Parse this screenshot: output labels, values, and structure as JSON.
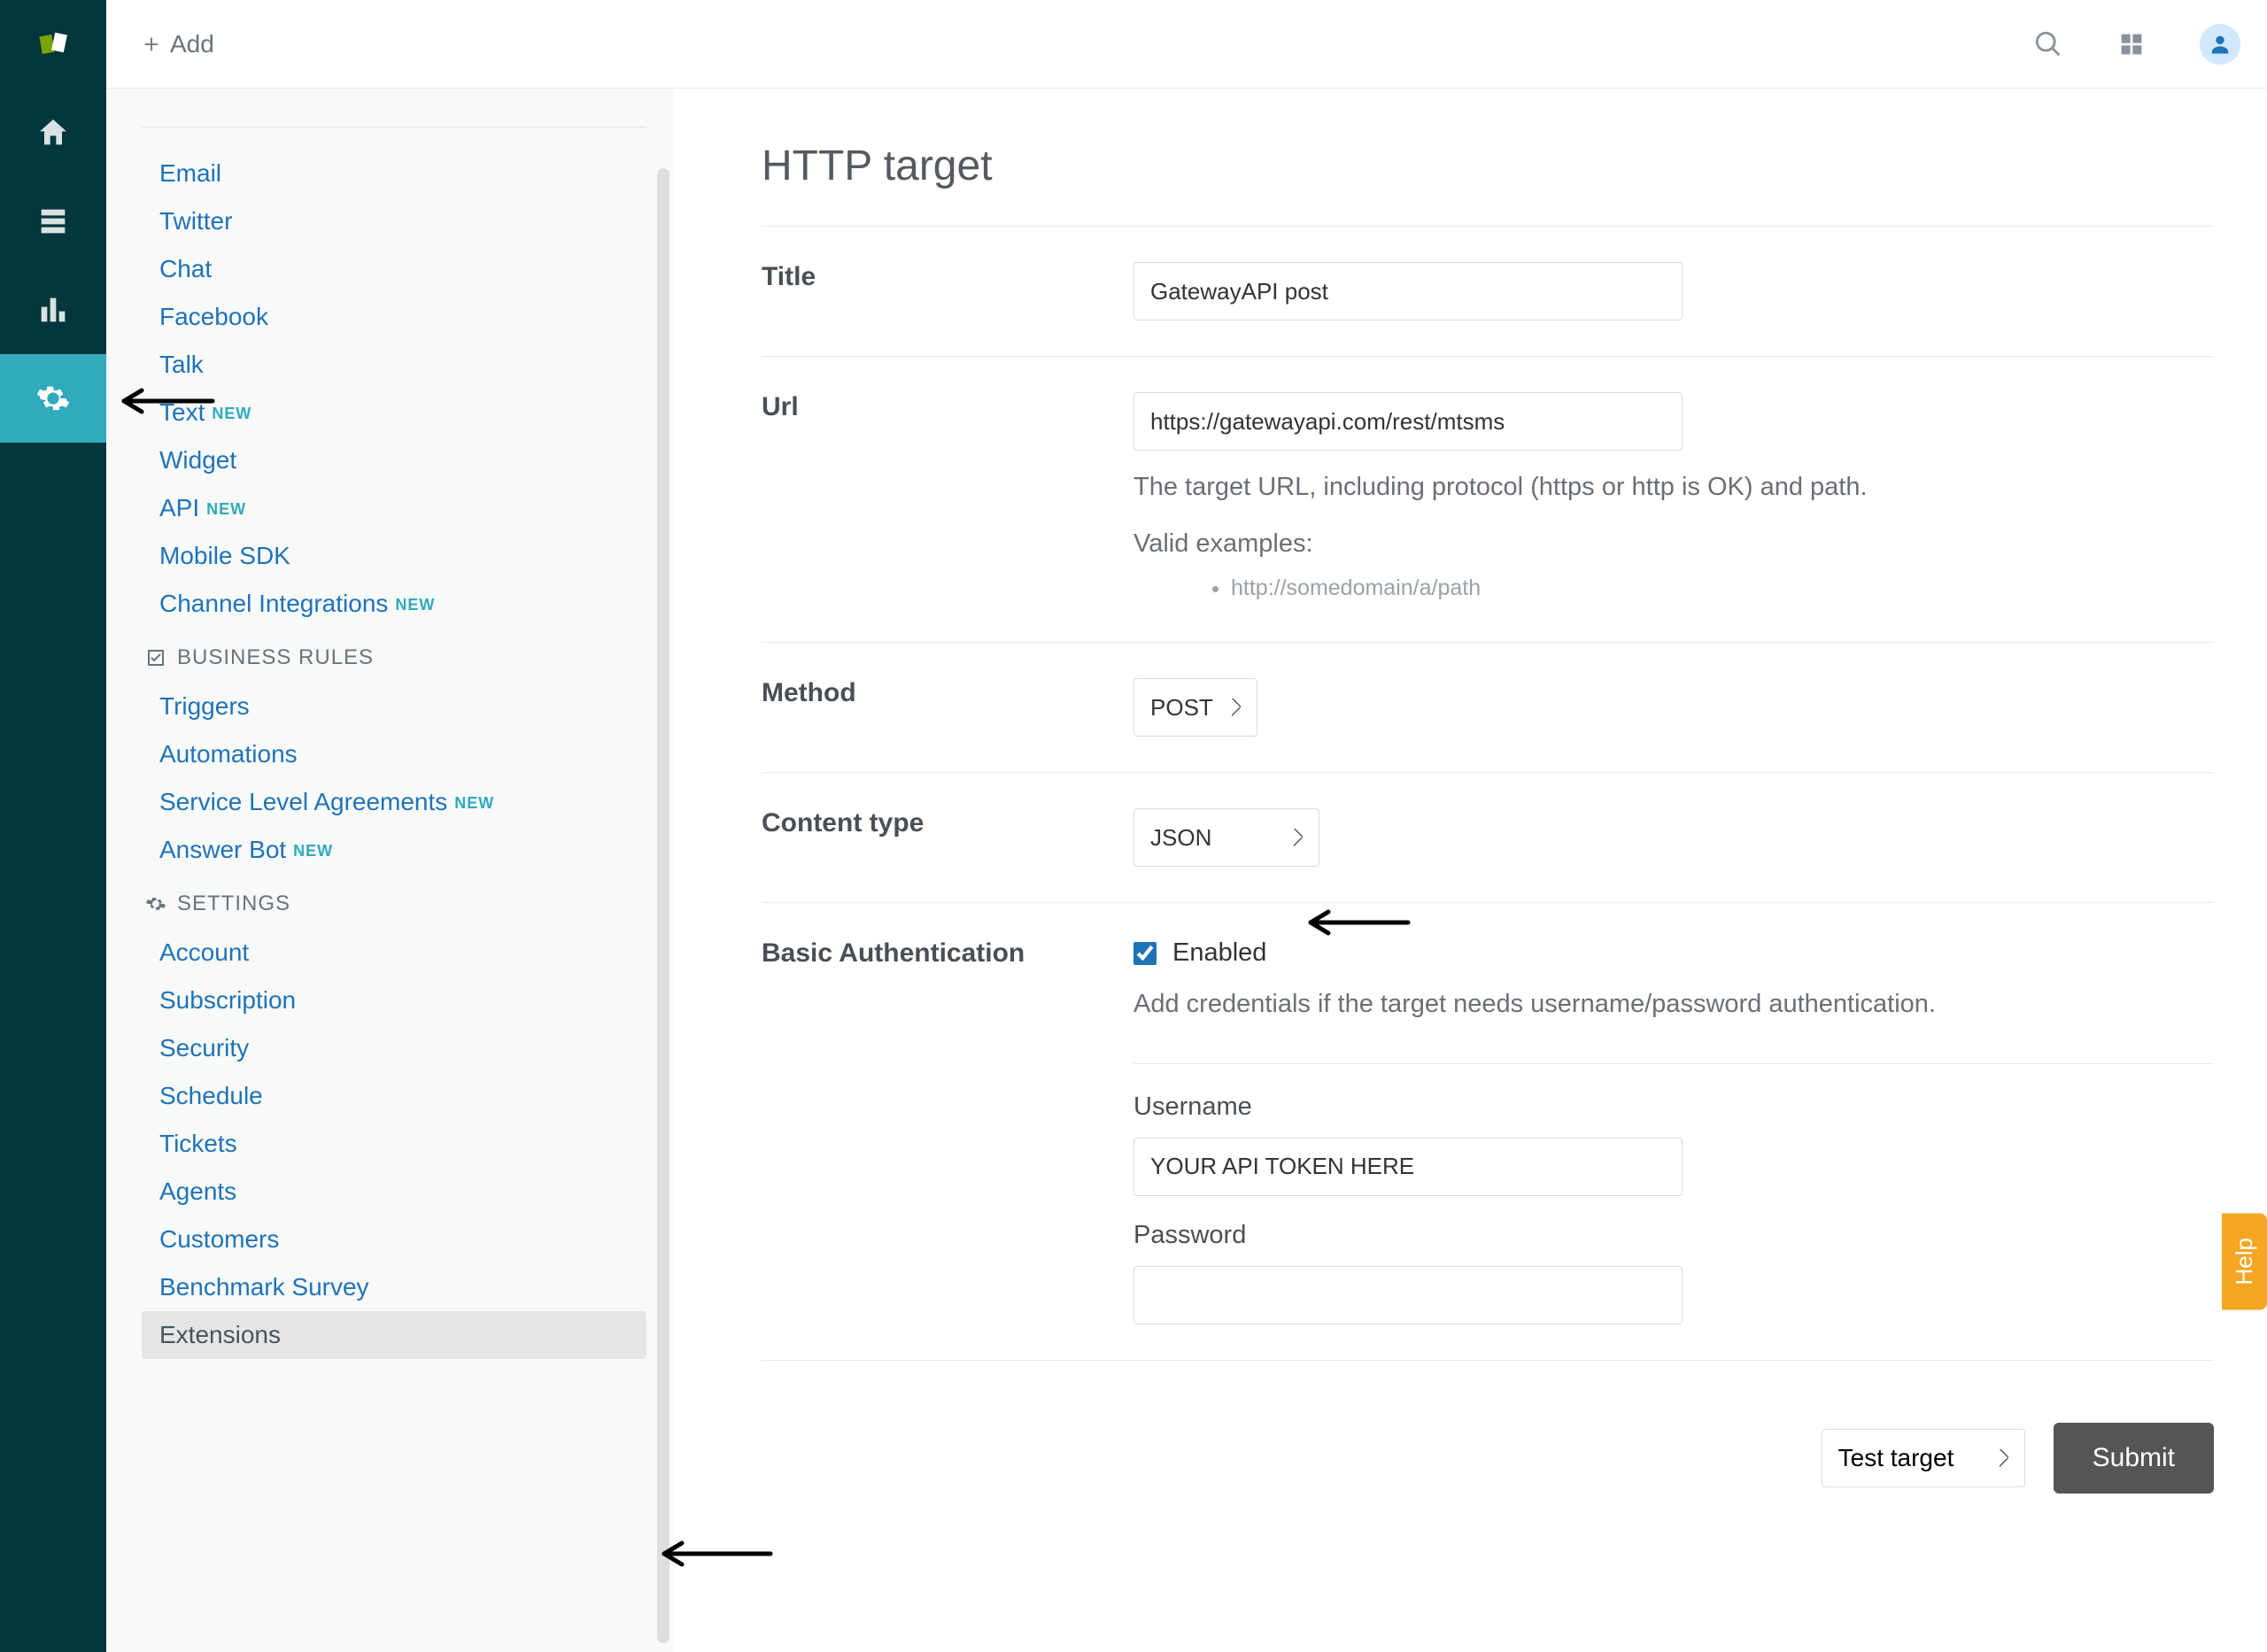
{
  "topbar": {
    "add_label": "Add"
  },
  "rail": {
    "items": [
      "home",
      "views",
      "reports",
      "admin"
    ],
    "active_index": 3
  },
  "sidebar": {
    "channels": [
      {
        "label": "Email"
      },
      {
        "label": "Twitter"
      },
      {
        "label": "Chat"
      },
      {
        "label": "Facebook"
      },
      {
        "label": "Talk"
      },
      {
        "label": "Text",
        "badge": "NEW"
      },
      {
        "label": "Widget"
      },
      {
        "label": "API",
        "badge": "NEW"
      },
      {
        "label": "Mobile SDK"
      },
      {
        "label": "Channel Integrations",
        "badge": "NEW"
      }
    ],
    "section_business": "BUSINESS RULES",
    "business": [
      {
        "label": "Triggers"
      },
      {
        "label": "Automations"
      },
      {
        "label": "Service Level Agreements",
        "badge": "NEW"
      },
      {
        "label": "Answer Bot",
        "badge": "NEW"
      }
    ],
    "section_settings": "SETTINGS",
    "settings": [
      {
        "label": "Account"
      },
      {
        "label": "Subscription"
      },
      {
        "label": "Security"
      },
      {
        "label": "Schedule"
      },
      {
        "label": "Tickets"
      },
      {
        "label": "Agents"
      },
      {
        "label": "Customers"
      },
      {
        "label": "Benchmark Survey"
      },
      {
        "label": "Extensions",
        "active": true
      }
    ]
  },
  "form": {
    "heading": "HTTP target",
    "title_label": "Title",
    "title_value": "GatewayAPI post",
    "url_label": "Url",
    "url_value": "https://gatewayapi.com/rest/mtsms",
    "url_help": "The target URL, including protocol (https or http is OK) and path.",
    "url_examples_intro": "Valid examples:",
    "url_examples": [
      "http://somedomain/a/path"
    ],
    "method_label": "Method",
    "method_value": "POST",
    "content_type_label": "Content type",
    "content_type_value": "JSON",
    "basic_auth_label": "Basic Authentication",
    "basic_auth_enabled_label": "Enabled",
    "basic_auth_help": "Add credentials if the target needs username/password authentication.",
    "username_label": "Username",
    "username_value": "YOUR API TOKEN HERE",
    "password_label": "Password",
    "password_value": "",
    "test_target_label": "Test target",
    "submit_label": "Submit"
  },
  "help_tab": "Help"
}
